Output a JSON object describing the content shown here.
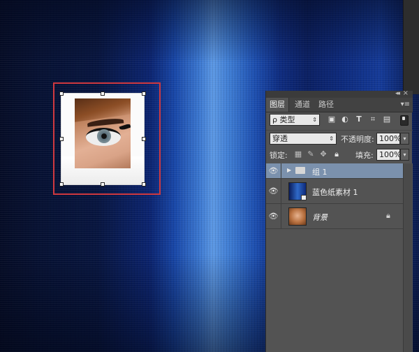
{
  "panel": {
    "tabs": [
      {
        "label": "图层",
        "active": true
      },
      {
        "label": "通道",
        "active": false
      },
      {
        "label": "路径",
        "active": false
      }
    ],
    "filter": {
      "kind_label": "ρ 类型",
      "icons": [
        "image-filter-icon",
        "adjustment-filter-icon",
        "type-filter-icon",
        "shape-filter-icon",
        "smart-object-filter-icon"
      ]
    },
    "blend_mode": "穿透",
    "opacity_label": "不透明度:",
    "opacity_value": "100%",
    "lock_label": "锁定:",
    "fill_label": "填充:",
    "fill_value": "100%",
    "layers": [
      {
        "name": "组 1",
        "type": "group",
        "selected": true,
        "visible": true
      },
      {
        "name": "蓝色纸素材 1",
        "type": "smart-object",
        "selected": false,
        "visible": true
      },
      {
        "name": "背景",
        "type": "background",
        "selected": false,
        "visible": true,
        "locked": true
      }
    ]
  },
  "colors": {
    "panel_bg": "#535353",
    "selected_layer": "#7b91ad",
    "selection_box": "#d0393f"
  }
}
